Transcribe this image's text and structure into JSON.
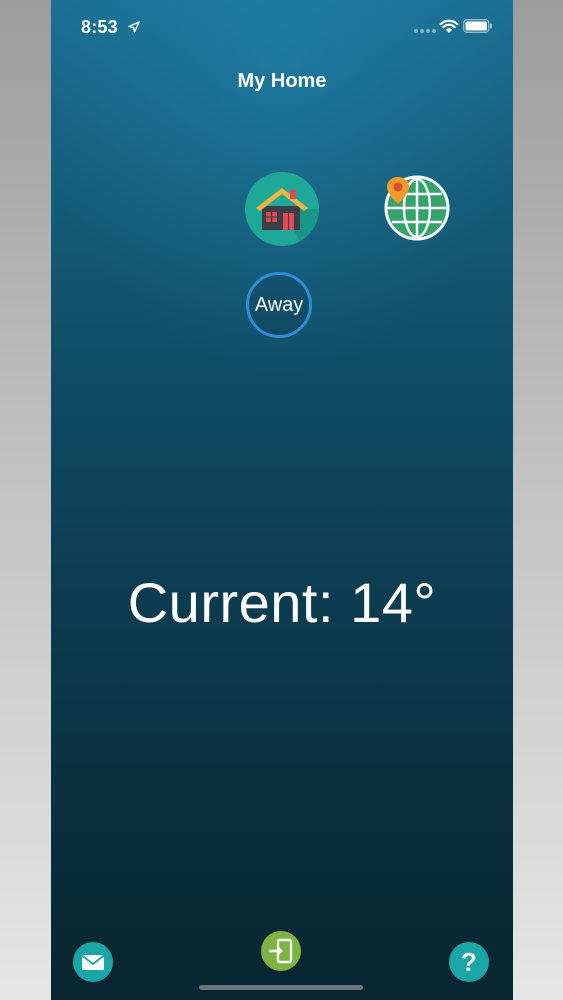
{
  "status_bar": {
    "time": "8:53",
    "location_icon": "location-arrow-icon",
    "signal_icon": "signal-dots-icon",
    "wifi_icon": "wifi-icon",
    "battery_icon": "battery-icon"
  },
  "header": {
    "title": "My Home"
  },
  "mode_icons": {
    "home": "home-icon",
    "geofence": "globe-location-icon"
  },
  "away_button": {
    "label": "Away",
    "border_color": "#2c8fd6"
  },
  "temperature": {
    "text": "Current: 14°"
  },
  "bottom_bar": {
    "mail": "mail-icon",
    "enter": "enter-icon",
    "help": "help-icon",
    "mail_color": "#1aa6a6",
    "enter_color": "#7cb342",
    "help_color": "#1aa6a6"
  },
  "colors": {
    "background_top": "#1b6f92",
    "background_bottom": "#082530",
    "text": "#ffffff"
  }
}
